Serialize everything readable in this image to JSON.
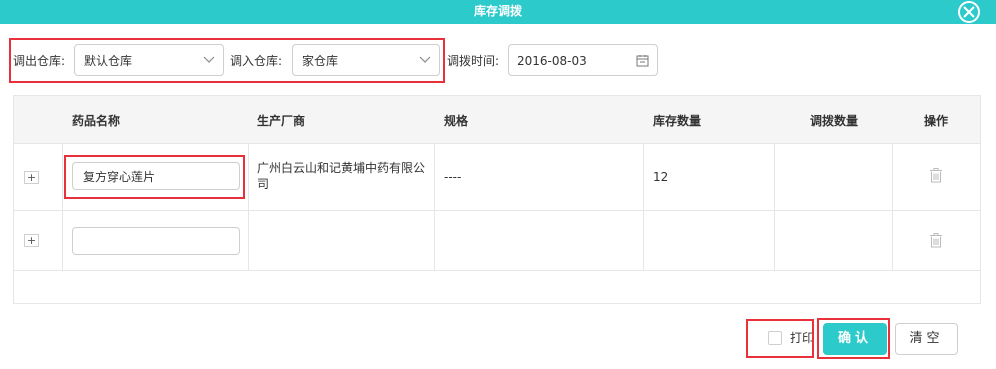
{
  "dialog": {
    "title": "库存调拨",
    "close_icon": "close-circle-icon",
    "accent_color": "#2ccacb",
    "highlight_color": "#e8313a"
  },
  "filters": {
    "out_label": "调出仓库:",
    "out_value": "默认仓库",
    "in_label": "调入仓库:",
    "in_value": "家仓库",
    "date_label": "调拨时间:",
    "date_value": "2016-08-03"
  },
  "table": {
    "columns": [
      "药品名称",
      "生产厂商",
      "规格",
      "库存数量",
      "调拨数量",
      "操作"
    ],
    "rows": [
      {
        "name": "复方穿心莲片",
        "maker": "广州白云山和记黄埔中药有限公司",
        "spec": "----",
        "stock": "12",
        "transfer": ""
      },
      {
        "name": "",
        "maker": "",
        "spec": "",
        "stock": "",
        "transfer": ""
      }
    ]
  },
  "footer": {
    "print_label": "打印",
    "print_checked": false,
    "confirm_label": "确认",
    "clear_label": "清空"
  }
}
